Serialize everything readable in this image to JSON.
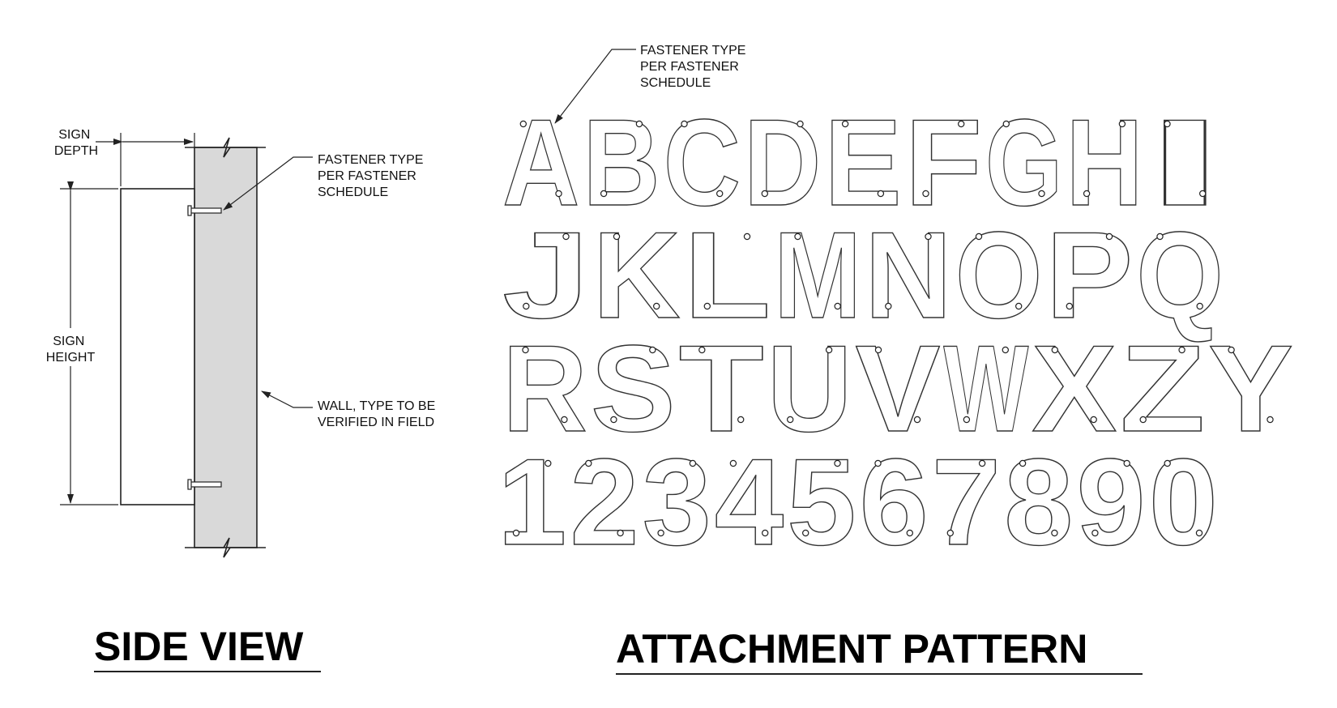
{
  "side_view": {
    "title": "SIDE VIEW",
    "sign_depth_label": [
      "SIGN",
      "DEPTH"
    ],
    "sign_height_label": [
      "SIGN",
      "HEIGHT"
    ],
    "fastener_note": [
      "FASTENER TYPE",
      "PER FASTENER",
      "SCHEDULE"
    ],
    "wall_note": [
      "WALL, TYPE TO BE",
      "VERIFIED IN FIELD"
    ],
    "colors": {
      "wall_fill": "#d9d9d9",
      "line": "#222222"
    }
  },
  "attachment_pattern": {
    "title": "ATTACHMENT PATTERN",
    "fastener_note": [
      "FASTENER TYPE",
      "PER FASTENER",
      "SCHEDULE"
    ],
    "rows": [
      [
        "A",
        "B",
        "C",
        "D",
        "E",
        "F",
        "G",
        "H",
        "I"
      ],
      [
        "J",
        "K",
        "L",
        "M",
        "N",
        "O",
        "P",
        "Q"
      ],
      [
        "R",
        "S",
        "T",
        "U",
        "V",
        "W",
        "X",
        "Z",
        "Y"
      ],
      [
        "1",
        "2",
        "3",
        "4",
        "5",
        "6",
        "7",
        "8",
        "9",
        "0"
      ]
    ],
    "fastener_hole_icon": "circle-icon"
  }
}
